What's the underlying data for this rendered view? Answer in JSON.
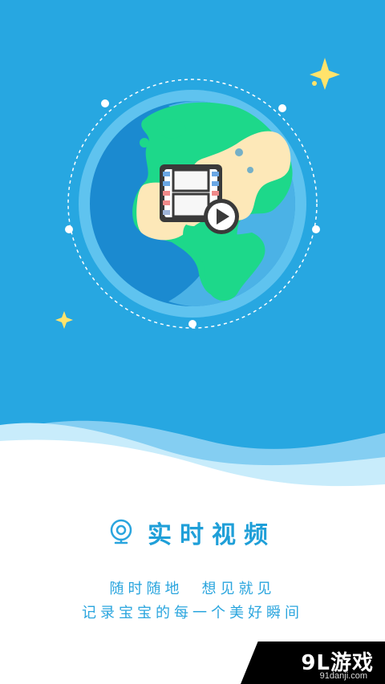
{
  "colors": {
    "sky": "#27a7e1",
    "accent_text": "#1f9fd8",
    "star": "#ffe36b",
    "ocean_light": "#5fc3ef",
    "ocean_dark": "#1b8ad0",
    "land_green": "#1dd88a",
    "land_sand": "#fde8b8"
  },
  "hero": {
    "icons": [
      "globe-icon",
      "film-strip-icon",
      "play-icon",
      "star-icon"
    ]
  },
  "feature": {
    "icon": "webcam-icon",
    "title": "实时视频"
  },
  "subtitle": {
    "line1": "随时随地　想见就见",
    "line2": "记录宝宝的每一个美好瞬间"
  },
  "watermark": {
    "main": "9L游戏",
    "sub": "91danji.com"
  }
}
